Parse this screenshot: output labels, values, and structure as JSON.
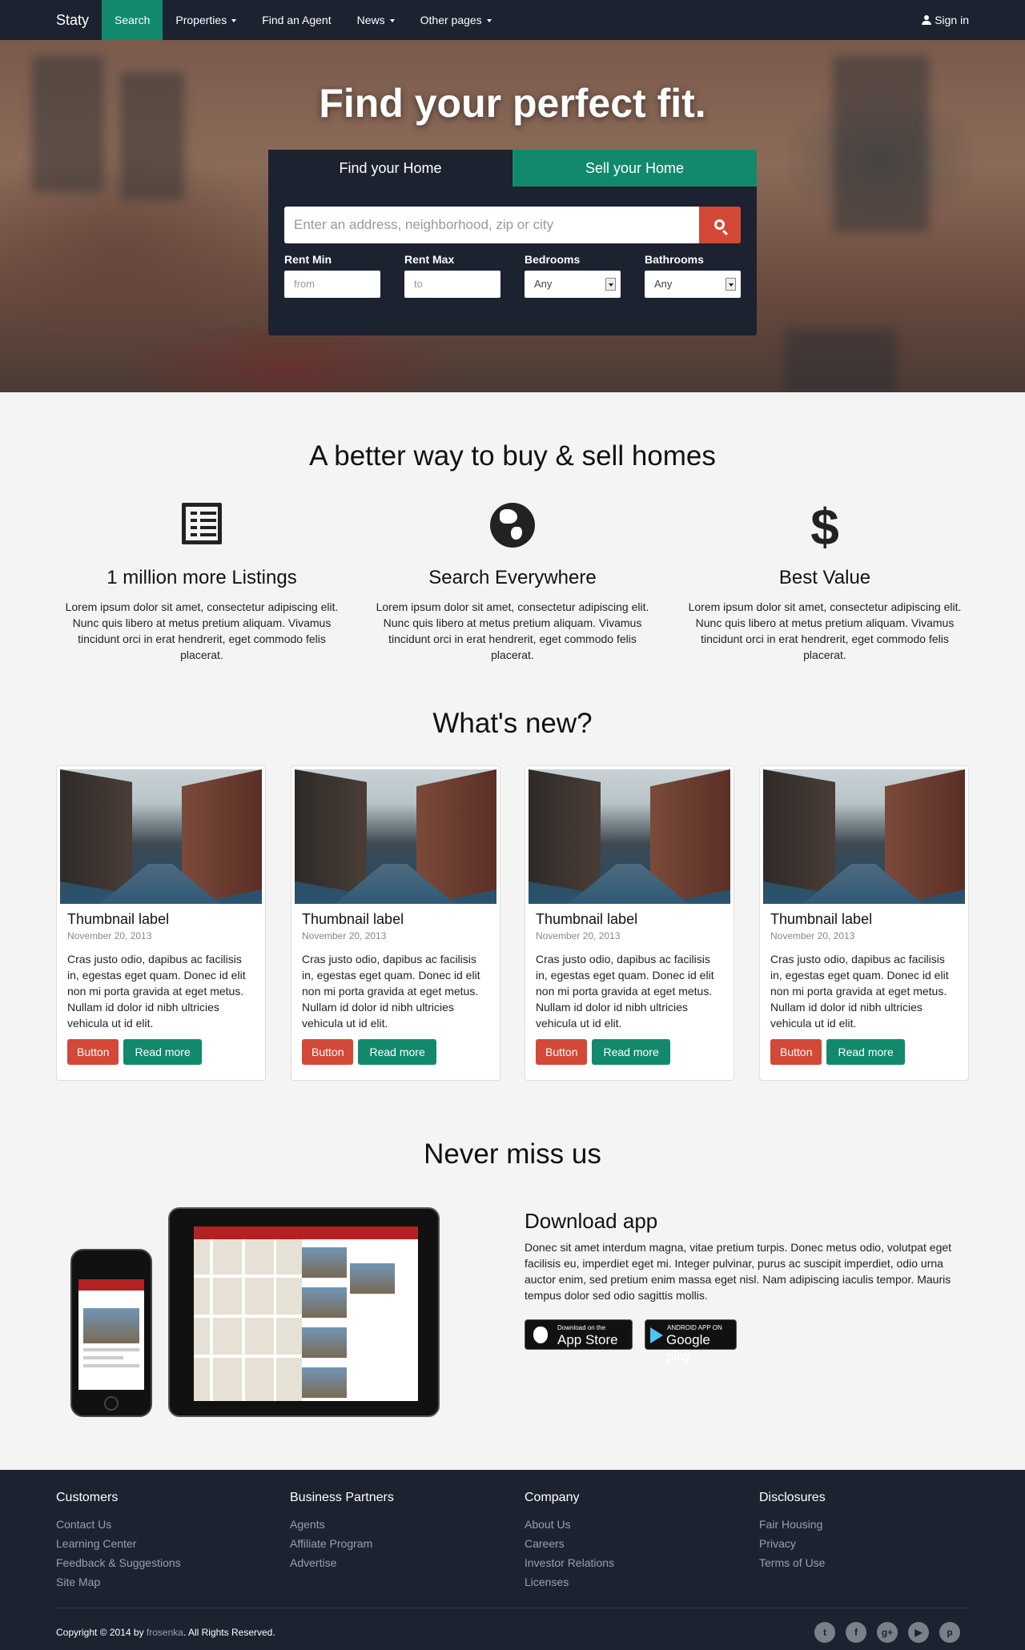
{
  "nav": {
    "brand": "Staty",
    "items": [
      {
        "label": "Search",
        "active": true,
        "dropdown": false
      },
      {
        "label": "Properties",
        "active": false,
        "dropdown": true
      },
      {
        "label": "Find an Agent",
        "active": false,
        "dropdown": false
      },
      {
        "label": "News",
        "active": false,
        "dropdown": true
      },
      {
        "label": "Other pages",
        "active": false,
        "dropdown": true
      }
    ],
    "signin": "Sign in"
  },
  "hero": {
    "title": "Find your perfect fit.",
    "tabs": [
      "Find your Home",
      "Sell your Home"
    ],
    "search_placeholder": "Enter an address, neighborhood, zip or city",
    "filters": {
      "rent_min": {
        "label": "Rent Min",
        "placeholder": "from"
      },
      "rent_max": {
        "label": "Rent Max",
        "placeholder": "to"
      },
      "bedrooms": {
        "label": "Bedrooms",
        "value": "Any"
      },
      "bathrooms": {
        "label": "Bathrooms",
        "value": "Any"
      }
    }
  },
  "features": {
    "title": "A better way to buy & sell homes",
    "items": [
      {
        "icon": "list-icon",
        "title": "1 million more Listings",
        "text": "Lorem ipsum dolor sit amet, consectetur adipiscing elit. Nunc quis libero at metus pretium aliquam. Vivamus tincidunt orci in erat hendrerit, eget commodo felis placerat."
      },
      {
        "icon": "globe-icon",
        "title": "Search Everywhere",
        "text": "Lorem ipsum dolor sit amet, consectetur adipiscing elit. Nunc quis libero at metus pretium aliquam. Vivamus tincidunt orci in erat hendrerit, eget commodo felis placerat."
      },
      {
        "icon": "dollar-icon",
        "title": "Best Value",
        "text": "Lorem ipsum dolor sit amet, consectetur adipiscing elit. Nunc quis libero at metus pretium aliquam. Vivamus tincidunt orci in erat hendrerit, eget commodo felis placerat."
      }
    ]
  },
  "news": {
    "title": "What's new?",
    "cards": [
      {
        "label": "Thumbnail label",
        "date": "November 20, 2013",
        "text": "Cras justo odio, dapibus ac facilisis in, egestas eget quam. Donec id elit non mi porta gravida at eget metus. Nullam id dolor id nibh ultricies vehicula ut id elit.",
        "button": "Button",
        "more": "Read more"
      },
      {
        "label": "Thumbnail label",
        "date": "November 20, 2013",
        "text": "Cras justo odio, dapibus ac facilisis in, egestas eget quam. Donec id elit non mi porta gravida at eget metus. Nullam id dolor id nibh ultricies vehicula ut id elit.",
        "button": "Button",
        "more": "Read more"
      },
      {
        "label": "Thumbnail label",
        "date": "November 20, 2013",
        "text": "Cras justo odio, dapibus ac facilisis in, egestas eget quam. Donec id elit non mi porta gravida at eget metus. Nullam id dolor id nibh ultricies vehicula ut id elit.",
        "button": "Button",
        "more": "Read more"
      },
      {
        "label": "Thumbnail label",
        "date": "November 20, 2013",
        "text": "Cras justo odio, dapibus ac facilisis in, egestas eget quam. Donec id elit non mi porta gravida at eget metus. Nullam id dolor id nibh ultricies vehicula ut id elit.",
        "button": "Button",
        "more": "Read more"
      }
    ]
  },
  "app": {
    "section_title": "Never miss us",
    "title": "Download app",
    "text": "Donec sit amet interdum magna, vitae pretium turpis. Donec metus odio, volutpat eget facilisis eu, imperdiet eget mi. Integer pulvinar, purus ac suscipit imperdiet, odio urna auctor enim, sed pretium enim massa eget nisl. Nam adipiscing iaculis tempor. Mauris tempus dolor sed odio sagittis mollis.",
    "appstore": {
      "small": "Download on the",
      "big": "App Store"
    },
    "googleplay": {
      "small": "ANDROID APP ON",
      "big": "Google play"
    }
  },
  "footer": {
    "columns": [
      {
        "title": "Customers",
        "links": [
          "Contact Us",
          "Learning Center",
          "Feedback & Suggestions",
          "Site Map"
        ]
      },
      {
        "title": "Business Partners",
        "links": [
          "Agents",
          "Affiliate Program",
          "Advertise"
        ]
      },
      {
        "title": "Company",
        "links": [
          "About Us",
          "Careers",
          "Investor Relations",
          "Licenses"
        ]
      },
      {
        "title": "Disclosures",
        "links": [
          "Fair Housing",
          "Privacy",
          "Terms of Use"
        ]
      }
    ],
    "copyright_prefix": "Copyright © 2014 by",
    "copyright_author": "frosenka",
    "copyright_suffix": ". All Rights Reserved.",
    "social": [
      {
        "icon": "twitter-icon",
        "glyph": "t"
      },
      {
        "icon": "facebook-icon",
        "glyph": "f"
      },
      {
        "icon": "google-plus-icon",
        "glyph": "g+"
      },
      {
        "icon": "youtube-icon",
        "glyph": "▶"
      },
      {
        "icon": "pinterest-icon",
        "glyph": "p"
      }
    ]
  }
}
